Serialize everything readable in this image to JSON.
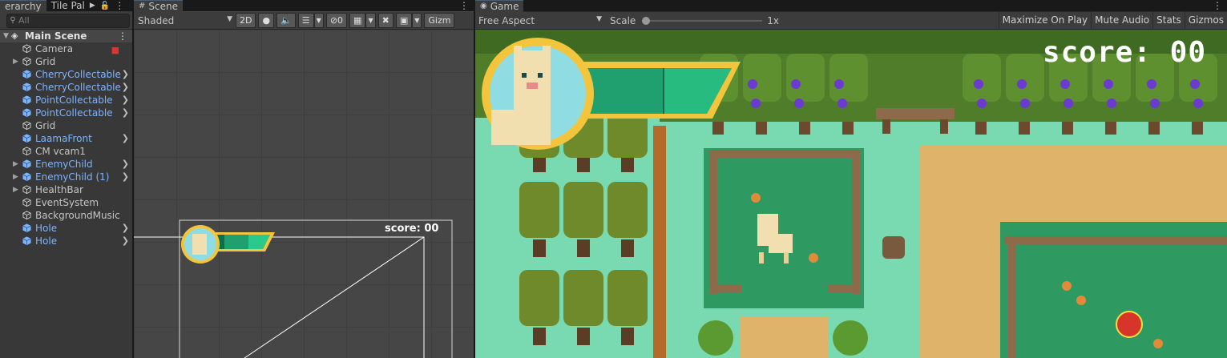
{
  "hierarchy": {
    "tabs": [
      {
        "label": "erarchy"
      },
      {
        "label": "Tile Pal"
      }
    ],
    "search_placeholder": "All",
    "scene_name": "Main Scene",
    "items": [
      {
        "label": "Camera",
        "prefab": false,
        "foldout": false,
        "arrow": false,
        "badge": true
      },
      {
        "label": "Grid",
        "prefab": false,
        "foldout": true,
        "arrow": false
      },
      {
        "label": "CherryCollectable",
        "prefab": true,
        "foldout": false,
        "arrow": true
      },
      {
        "label": "CherryCollectable",
        "prefab": true,
        "foldout": false,
        "arrow": true
      },
      {
        "label": "PointCollectable",
        "prefab": true,
        "foldout": false,
        "arrow": true
      },
      {
        "label": "PointCollectable",
        "prefab": true,
        "foldout": false,
        "arrow": true
      },
      {
        "label": "Grid",
        "prefab": false,
        "foldout": false,
        "arrow": false
      },
      {
        "label": "LaamaFront",
        "prefab": true,
        "foldout": false,
        "arrow": true
      },
      {
        "label": "CM vcam1",
        "prefab": false,
        "foldout": false,
        "arrow": false
      },
      {
        "label": "EnemyChild",
        "prefab": true,
        "foldout": true,
        "arrow": true
      },
      {
        "label": "EnemyChild (1)",
        "prefab": true,
        "foldout": true,
        "arrow": true
      },
      {
        "label": "HealthBar",
        "prefab": false,
        "foldout": true,
        "arrow": false
      },
      {
        "label": "EventSystem",
        "prefab": false,
        "foldout": false,
        "arrow": false
      },
      {
        "label": "BackgroundMusic",
        "prefab": false,
        "foldout": false,
        "arrow": false
      },
      {
        "label": "Hole",
        "prefab": true,
        "foldout": false,
        "arrow": true
      },
      {
        "label": "Hole",
        "prefab": true,
        "foldout": false,
        "arrow": true
      }
    ]
  },
  "scene": {
    "tab_label": "Scene",
    "shading_mode": "Shaded",
    "mode_2d": "2D",
    "hidden_count": "0",
    "gizmos": "Gizm",
    "score_text": "score: 00"
  },
  "game": {
    "tab_label": "Game",
    "aspect": "Free Aspect",
    "scale_label": "Scale",
    "scale_value": "1x",
    "scale_fraction": 0,
    "buttons": [
      "Maximize On Play",
      "Mute Audio",
      "Stats",
      "Gizmos"
    ],
    "score_text": "score: 00",
    "health_fraction": 0.98
  },
  "colors": {
    "prefab_blue": "#7cb4ff",
    "health_dark": "#0e6e4a",
    "health_light": "#2bc98a",
    "frame_yellow": "#f2c53d",
    "grass": "#79d9b0",
    "tree_green": "#5d8a2a"
  }
}
